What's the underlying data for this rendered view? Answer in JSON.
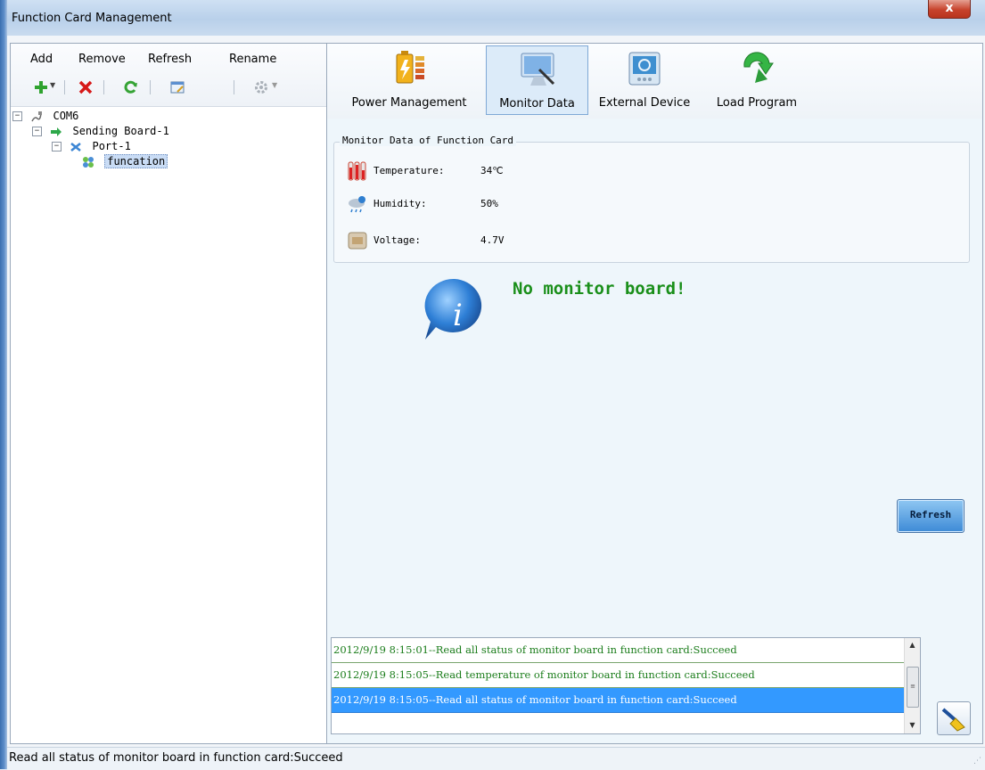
{
  "window": {
    "title": "Function Card Management",
    "close_label": "x"
  },
  "left_menu": {
    "add": "Add",
    "remove": "Remove",
    "refresh": "Refresh",
    "rename": "Rename"
  },
  "toolbar_icons": [
    "add-icon",
    "delete-icon",
    "refresh-icon",
    "rename-icon",
    "settings-icon"
  ],
  "tree": {
    "com": "COM6",
    "sending_board": "Sending Board-1",
    "port": "Port-1",
    "card": "funcation"
  },
  "tabs": [
    {
      "label": "Power Management",
      "icon": "battery-icon"
    },
    {
      "label": "Monitor Data",
      "icon": "monitor-icon"
    },
    {
      "label": "External Device",
      "icon": "external-device-icon"
    },
    {
      "label": "Load Program",
      "icon": "load-program-icon"
    }
  ],
  "active_tab": "Monitor Data",
  "monitor": {
    "group_title": "Monitor Data of Function Card",
    "temperature_label": "Temperature:",
    "temperature_value": "34℃",
    "humidity_label": "Humidity:",
    "humidity_value": "50%",
    "voltage_label": "Voltage:",
    "voltage_value": "4.7V"
  },
  "notice": {
    "text": "No monitor board!"
  },
  "refresh_button": "Refresh",
  "log": [
    "2012/9/19 8:15:01--Read all status of monitor board in function card:Succeed",
    "2012/9/19 8:15:05--Read temperature of monitor board in function card:Succeed",
    "2012/9/19 8:15:05--Read all status of monitor board in function card:Succeed"
  ],
  "log_selected_index": 2,
  "status": {
    "text": "Read all status of monitor board in function card:Succeed"
  },
  "colors": {
    "accent": "#3399ff",
    "success_text": "#1b7d1b",
    "notice_text": "#1a8f1a"
  }
}
